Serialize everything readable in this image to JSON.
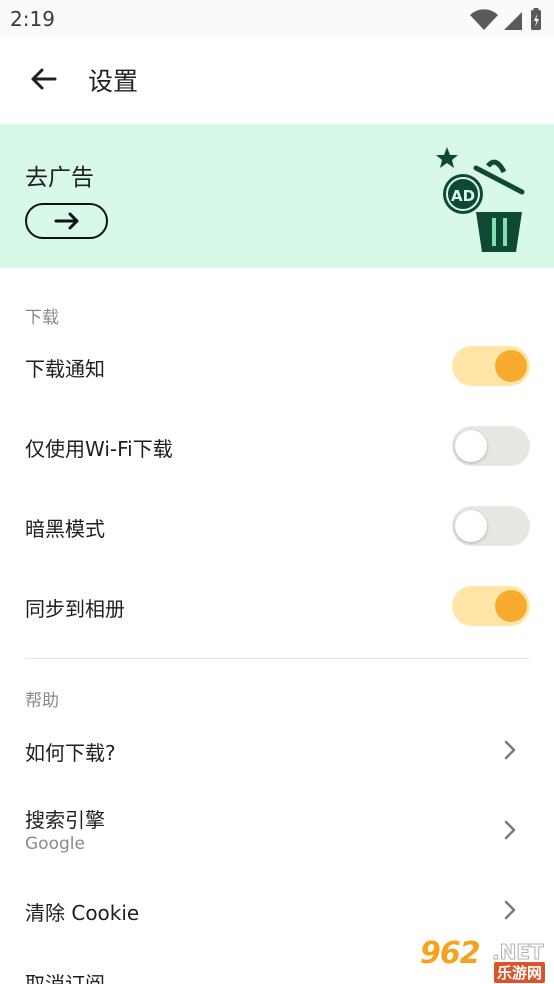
{
  "status_bar": {
    "time": "2:19"
  },
  "toolbar": {
    "title": "设置"
  },
  "promo": {
    "title": "去广告",
    "badge_text": "AD"
  },
  "sections": {
    "download": {
      "header": "下载"
    },
    "help": {
      "header": "帮助"
    }
  },
  "settings": {
    "download_notify": {
      "label": "下载通知",
      "enabled": true
    },
    "wifi_only": {
      "label": "仅使用Wi-Fi下载",
      "enabled": false
    },
    "dark_mode": {
      "label": "暗黑模式",
      "enabled": false
    },
    "sync_album": {
      "label": "同步到相册",
      "enabled": true
    }
  },
  "help_items": {
    "how_to_download": {
      "label": "如何下载?"
    },
    "search_engine": {
      "label": "搜索引擎",
      "value": "Google"
    },
    "clear_cookie": {
      "label": "清除 Cookie"
    },
    "next_item_partial": {
      "label": "取消订阅"
    }
  },
  "watermark": {
    "number": "962",
    "net": ".NET",
    "site": "乐游网"
  },
  "colors": {
    "promo_bg": "#d8f8e9",
    "toggle_on_track": "#fde6a8",
    "toggle_on_knob": "#f9ab2f",
    "toggle_off_track": "#e7e7e2",
    "illustration_green": "#0e4a33"
  },
  "icons": [
    "wifi-icon",
    "signal-icon",
    "battery-icon",
    "back-arrow-icon",
    "arrow-right-icon",
    "star-icon",
    "trash-icon",
    "chevron-right-icon"
  ]
}
